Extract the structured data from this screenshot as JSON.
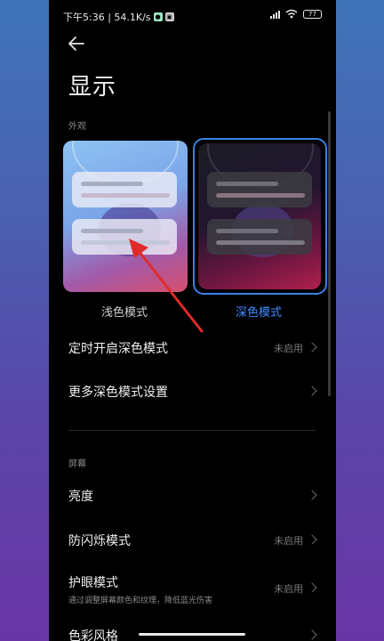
{
  "status": {
    "time_speed": "下午5:36 | 54.1K/s",
    "battery": "77"
  },
  "header": {
    "title": "显示"
  },
  "appearance": {
    "section_label": "外观",
    "light_label": "浅色模式",
    "dark_label": "深色模式",
    "selected": "dark"
  },
  "settings": [
    {
      "title": "定时开启深色模式",
      "value": "未启用"
    },
    {
      "title": "更多深色模式设置",
      "value": ""
    }
  ],
  "screen": {
    "section_label": "屏幕",
    "items": [
      {
        "title": "亮度",
        "value": "",
        "subtitle": ""
      },
      {
        "title": "防闪烁模式",
        "value": "未启用",
        "subtitle": ""
      },
      {
        "title": "护眼模式",
        "value": "未启用",
        "subtitle": "通过调整屏幕颜色和纹理，降低蓝光伤害"
      },
      {
        "title": "色彩风格",
        "value": "",
        "subtitle": ""
      }
    ]
  },
  "colors": {
    "accent": "#3f8cff",
    "annotation_arrow": "#e02a2a"
  }
}
